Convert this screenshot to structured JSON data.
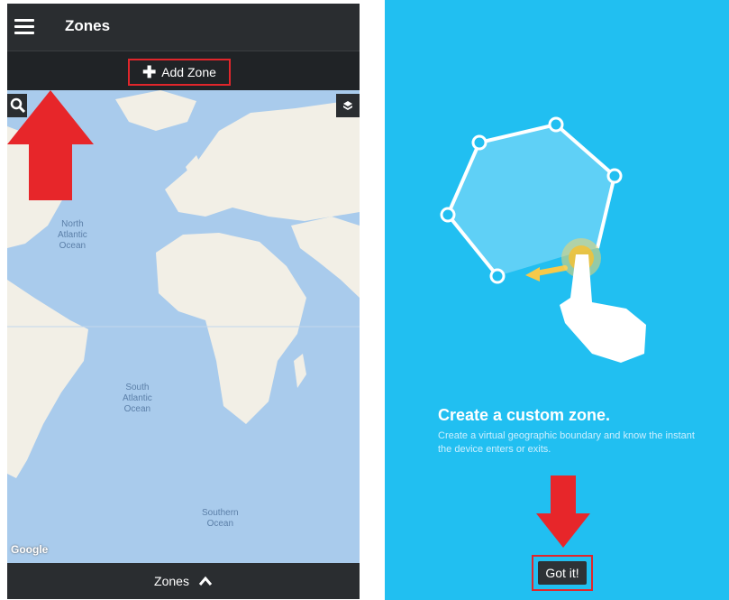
{
  "left": {
    "appbar": {
      "title": "Zones"
    },
    "toolbar": {
      "add_zone_label": "Add Zone"
    },
    "map": {
      "labels": {
        "north_atlantic": "North\nAtlantic\nOcean",
        "south_atlantic": "South\nAtlantic\nOcean",
        "southern_ocean": "Southern\nOcean"
      },
      "attribution": "Google"
    },
    "bottom_bar": {
      "label": "Zones"
    }
  },
  "right": {
    "tutorial": {
      "heading": "Create a custom zone.",
      "body": "Create a virtual geographic boundary and know the instant the device enters or exits.",
      "button": "Got it!"
    }
  },
  "colors": {
    "dark_bar": "#2a2d30",
    "map_water": "#a9cbec",
    "land": "#f2efe6",
    "highlight_red": "#e0262b",
    "tutorial_bg": "#21bff1"
  }
}
